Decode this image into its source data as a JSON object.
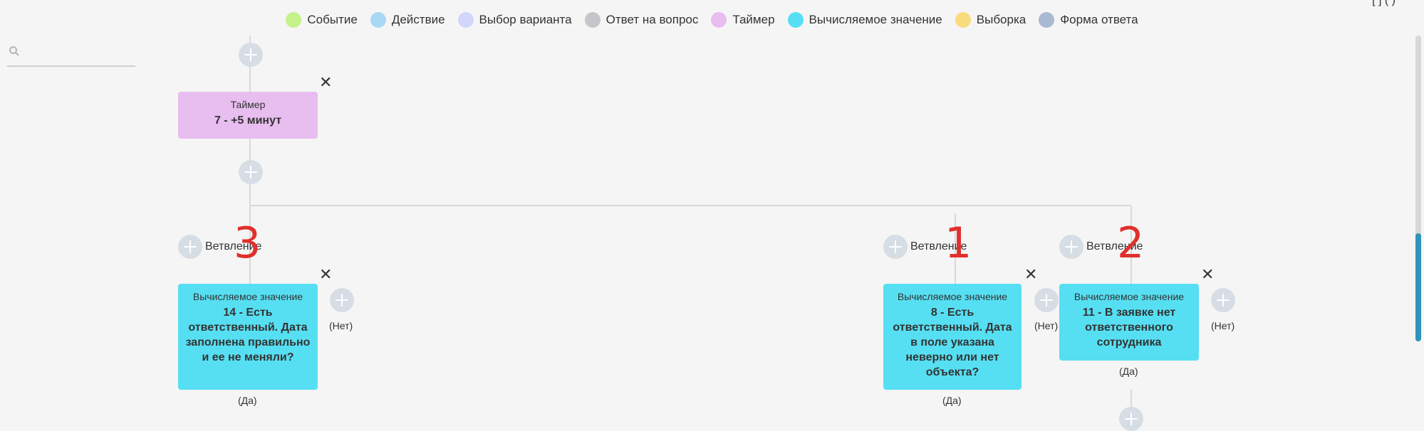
{
  "legend": [
    {
      "label": "Событие",
      "color": "#c6f28b"
    },
    {
      "label": "Действие",
      "color": "#a9d8f5"
    },
    {
      "label": "Выбор варианта",
      "color": "#d3d6fb"
    },
    {
      "label": "Ответ на вопрос",
      "color": "#c4c6c9"
    },
    {
      "label": "Таймер",
      "color": "#e8bdf0"
    },
    {
      "label": "Вычисляемое значение",
      "color": "#56dff2"
    },
    {
      "label": "Выборка",
      "color": "#f8dc7e"
    },
    {
      "label": "Форма ответа",
      "color": "#a9b9d1"
    }
  ],
  "search": {
    "placeholder": ""
  },
  "top_corner": "[ ]  ( )",
  "close_glyph": "✕",
  "timer_node": {
    "type": "Таймер",
    "title": "7 - +5 минут"
  },
  "branch_label": "Ветвление",
  "yes_label": "(Да)",
  "no_label": "(Нет)",
  "calc_node_14": {
    "type": "Вычисляемое значение",
    "title": "14 - Есть ответственный. Дата заполнена правильно и ее не меняли?"
  },
  "calc_node_8": {
    "type": "Вычисляемое значение",
    "title": "8 - Есть ответственный. Дата в поле указана неверно или нет объекта?"
  },
  "calc_node_11": {
    "type": "Вычисляемое значение",
    "title": "11 - В заявке нет ответственного сотрудника"
  },
  "annotations": {
    "a1": "1",
    "a2": "2",
    "a3": "3"
  }
}
